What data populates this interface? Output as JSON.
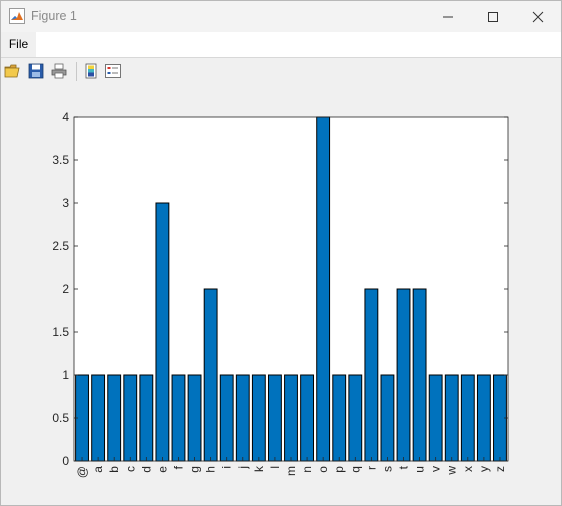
{
  "window": {
    "title": "Figure 1"
  },
  "menu": {
    "file_label": "File"
  },
  "toolbar": {
    "icons": [
      "open-icon",
      "save-icon",
      "print-icon",
      "colorbar-icon",
      "legend-icon"
    ]
  },
  "colors": {
    "bar_fill": "#0072BD",
    "bar_edge": "#000000",
    "axes_bg": "#ffffff",
    "figure_bg": "#f0f0f0"
  },
  "chart_data": {
    "type": "bar",
    "categories": [
      "@",
      "a",
      "b",
      "c",
      "d",
      "e",
      "f",
      "g",
      "h",
      "i",
      "j",
      "k",
      "l",
      "m",
      "n",
      "o",
      "p",
      "q",
      "r",
      "s",
      "t",
      "u",
      "v",
      "w",
      "x",
      "y",
      "z"
    ],
    "values": [
      1,
      1,
      1,
      1,
      1,
      3,
      1,
      1,
      2,
      1,
      1,
      1,
      1,
      1,
      1,
      4,
      1,
      1,
      2,
      1,
      2,
      2,
      1,
      1,
      1,
      1,
      1
    ],
    "yticks": [
      "0",
      "0.5",
      "1",
      "1.5",
      "2",
      "2.5",
      "3",
      "3.5",
      "4"
    ],
    "ylim": [
      0,
      4
    ],
    "title": "",
    "xlabel": "",
    "ylabel": "",
    "grid": false
  }
}
